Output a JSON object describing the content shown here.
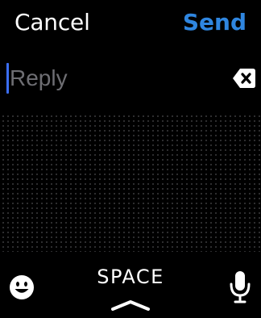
{
  "header": {
    "cancel_label": "Cancel",
    "send_label": "Send"
  },
  "reply": {
    "placeholder": "Reply",
    "value": ""
  },
  "keyboard": {
    "space_label": "SPACE"
  },
  "icons": {
    "backspace": "backspace-icon",
    "emoji": "emoji-icon",
    "microphone": "microphone-icon",
    "expand": "chevron-up-icon"
  },
  "colors": {
    "background": "#000000",
    "accent": "#2f86e0",
    "cursor": "#3b6ef5",
    "placeholder": "#6e6e73",
    "dots": "#3a3a3c"
  }
}
